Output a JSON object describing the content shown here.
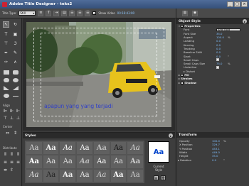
{
  "window": {
    "title": "Adobe Title Designer - teks2",
    "buttons": [
      "_",
      "□",
      "×"
    ]
  },
  "toolbar": {
    "title_type_label": "Title Type:",
    "title_type_value": "Still",
    "show_video_label": "Show Video",
    "timecode": "00:16:43:00"
  },
  "toolbox": {
    "align_label": "Align",
    "center_label": "Center",
    "distribute_label": "Distribute"
  },
  "canvas": {
    "caption_text": "apapun yang yang terjadi"
  },
  "styles": {
    "title": "Styles",
    "current_sample": "Aa",
    "current_label_1": "Current",
    "current_label_2": "Style",
    "swatches": [
      {
        "text": "Aa",
        "color": "#d8d8d8"
      },
      {
        "text": "Aa",
        "color": "#f0f0f0"
      },
      {
        "text": "Aa",
        "color": "#ffffff"
      },
      {
        "text": "Aa",
        "color": "#ffffff"
      },
      {
        "text": "Aa",
        "color": "#bfbfbf"
      },
      {
        "text": "Aa",
        "color": "#111111"
      },
      {
        "text": "Aa",
        "color": "#dcdcdc"
      },
      {
        "text": "Aa",
        "color": "#ffffff"
      },
      {
        "text": "Aa",
        "color": "#e0e0e0"
      },
      {
        "text": "Aa",
        "color": "#dddddd"
      },
      {
        "text": "Aa",
        "color": "#bbbbbb"
      },
      {
        "text": "Aa",
        "color": "#ffffff"
      },
      {
        "text": "Aa",
        "color": "#dddddd"
      },
      {
        "text": "Aa",
        "color": "#cccccc"
      },
      {
        "text": "Aa",
        "color": "#e8e8e8"
      },
      {
        "text": "Aa",
        "color": "#222222"
      },
      {
        "text": "Aa",
        "color": "#eeeeee"
      },
      {
        "text": "Aa",
        "color": "#eeeeee"
      },
      {
        "text": "Aa",
        "color": "#d5d5d5"
      },
      {
        "text": "Aa",
        "color": "#ffffff"
      },
      {
        "text": "Aa",
        "color": "#cfcfcf"
      }
    ]
  },
  "object_style": {
    "title": "Object Style",
    "properties_label": "Properties",
    "font_label": "Font",
    "font_value": "Arial Bold",
    "font_size_label": "Font Size",
    "font_size_value": "35.0",
    "aspect_label": "Aspect",
    "aspect_value": "100.0",
    "aspect_unit": "%",
    "leading_label": "Leading",
    "leading_value": "0.0",
    "kerning_label": "Kerning",
    "kerning_value": "0.0",
    "tracking_label": "Tracking",
    "tracking_value": "0.0",
    "baseline_label": "Baseline Shift",
    "baseline_value": "0.0",
    "slant_label": "Slant",
    "slant_value": "0.0",
    "slant_unit": "°",
    "small_caps_label": "Small Caps",
    "small_caps_size_label": "Small Caps Size",
    "small_caps_size_value": "75.0",
    "small_caps_size_unit": "%",
    "underline_label": "Underline",
    "distort_label": "Distort",
    "fill_label": "Fill",
    "strokes_label": "Strokes",
    "shadow_label": "Shadow"
  },
  "transform": {
    "title": "Transform",
    "opacity_label": "Opacity",
    "opacity_value": "100.0",
    "opacity_unit": "%",
    "x_label": "X Position",
    "x_value": "329.7",
    "y_label": "Y Position",
    "y_value": "453.1",
    "width_label": "Width",
    "width_value": "449.0",
    "height_label": "Height",
    "height_value": "35.0",
    "rotation_label": "Rotation",
    "rotation_value": "0.0",
    "rotation_unit": "°"
  }
}
